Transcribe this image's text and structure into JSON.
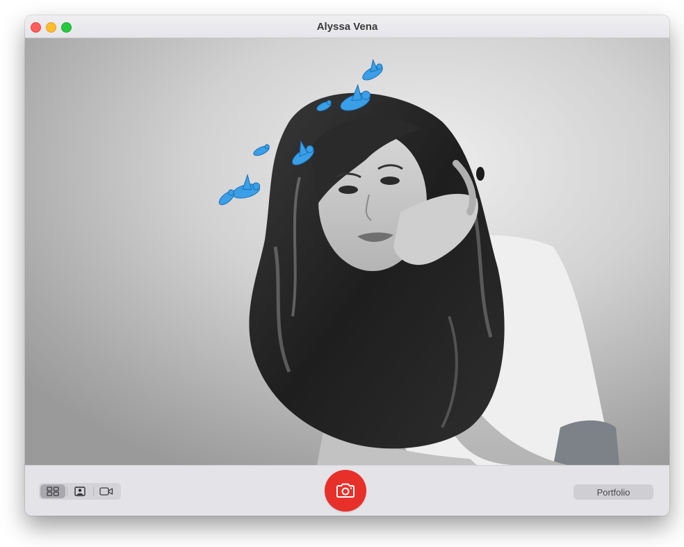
{
  "window": {
    "title": "Alyssa Vena"
  },
  "viewfinder": {
    "subject": "black-and-white portrait of a woman resting her chin on her hands",
    "effect": "blue-birds-halo"
  },
  "toolbar": {
    "modes": [
      {
        "icon": "grid-icon",
        "selected": true
      },
      {
        "icon": "portrait-icon",
        "selected": false
      },
      {
        "icon": "video-icon",
        "selected": false
      }
    ],
    "shutter_icon": "camera-icon",
    "portfolio_label": "Portfolio"
  },
  "colors": {
    "shutter": "#e8302a",
    "bird": "#3a9fe6",
    "traffic_close": "#fe5f57",
    "traffic_minimize": "#febc2e",
    "traffic_zoom": "#28c840"
  }
}
